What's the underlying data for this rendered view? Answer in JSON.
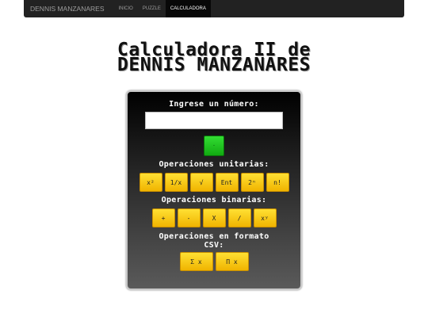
{
  "navbar": {
    "brand": "DENNIS MANZANARES",
    "items": [
      {
        "label": "INICIO",
        "active": false
      },
      {
        "label": "PUZZLE",
        "active": false
      },
      {
        "label": "CALCULADORA",
        "active": true
      }
    ]
  },
  "title": {
    "line1": "Calculadora II de",
    "line2": "DENNIS MANZANARES"
  },
  "calculator": {
    "input_label": "Ingrese un número:",
    "input_value": "",
    "submit_label": "·",
    "unary_label": "Operaciones unitarias:",
    "unary_buttons": [
      "x²",
      "1/x",
      "√",
      "Ent",
      "2ⁿ",
      "n!"
    ],
    "binary_label": "Operaciones binarias:",
    "binary_buttons": [
      "+",
      "-",
      "X",
      "/",
      "xʸ"
    ],
    "csv_label_line1": "Operaciones en formato",
    "csv_label_line2": "CSV:",
    "csv_buttons": [
      "Σ x",
      "Π x"
    ]
  },
  "colors": {
    "navbar_bg": "#222222",
    "button_yellow": "#f5c400",
    "button_green": "#22cc22"
  }
}
